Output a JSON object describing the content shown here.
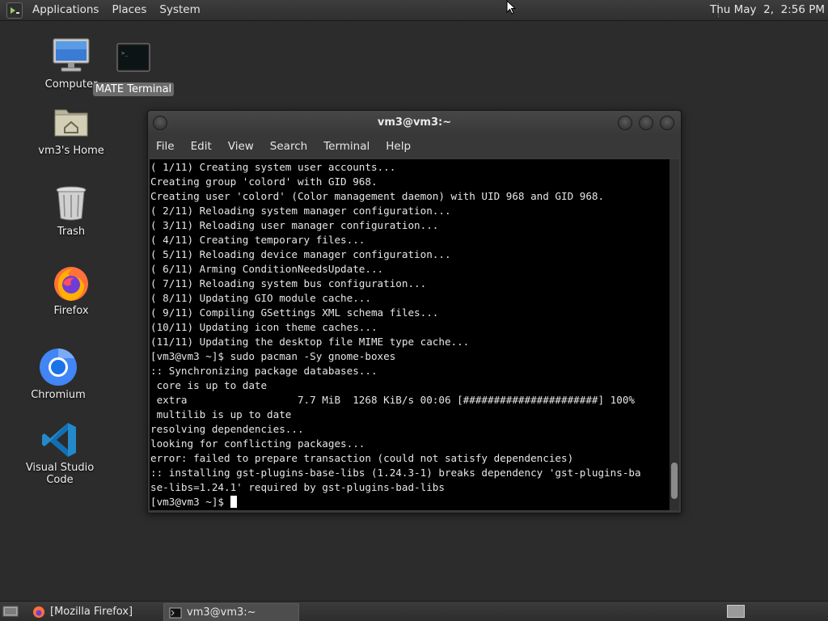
{
  "top_panel": {
    "menus": [
      "Applications",
      "Places",
      "System"
    ],
    "clock": "Thu May  2,  2:56 PM"
  },
  "desktop_icons": [
    {
      "label": "Computer",
      "icon": "computer-icon"
    },
    {
      "label": "MATE Terminal",
      "icon": "terminal-icon",
      "selected": true
    },
    {
      "label": "vm3's Home",
      "icon": "home-folder-icon"
    },
    {
      "label": "Trash",
      "icon": "trash-icon"
    },
    {
      "label": "Firefox",
      "icon": "firefox-icon"
    },
    {
      "label": "Chromium",
      "icon": "chromium-icon"
    },
    {
      "label": "Visual Studio Code",
      "icon": "vscode-icon"
    }
  ],
  "terminal": {
    "title": "vm3@vm3:~",
    "menu": [
      "File",
      "Edit",
      "View",
      "Search",
      "Terminal",
      "Help"
    ],
    "lines": [
      "( 1/11) Creating system user accounts...",
      "Creating group 'colord' with GID 968.",
      "Creating user 'colord' (Color management daemon) with UID 968 and GID 968.",
      "( 2/11) Reloading system manager configuration...",
      "( 3/11) Reloading user manager configuration...",
      "( 4/11) Creating temporary files...",
      "( 5/11) Reloading device manager configuration...",
      "( 6/11) Arming ConditionNeedsUpdate...",
      "( 7/11) Reloading system bus configuration...",
      "( 8/11) Updating GIO module cache...",
      "( 9/11) Compiling GSettings XML schema files...",
      "(10/11) Updating icon theme caches...",
      "(11/11) Updating the desktop file MIME type cache...",
      "[vm3@vm3 ~]$ sudo pacman -Sy gnome-boxes",
      ":: Synchronizing package databases...",
      " core is up to date",
      " extra                  7.7 MiB  1268 KiB/s 00:06 [######################] 100%",
      " multilib is up to date",
      "resolving dependencies...",
      "looking for conflicting packages...",
      "error: failed to prepare transaction (could not satisfy dependencies)",
      ":: installing gst-plugins-base-libs (1.24.3-1) breaks dependency 'gst-plugins-ba",
      "se-libs=1.24.1' required by gst-plugins-bad-libs"
    ],
    "prompt": "[vm3@vm3 ~]$ "
  },
  "taskbar": [
    {
      "label": "[Mozilla Firefox]",
      "icon": "firefox-icon",
      "active": false
    },
    {
      "label": "vm3@vm3:~",
      "icon": "terminal-icon",
      "active": true
    }
  ],
  "colors": {
    "panel": "#333333",
    "desktop": "#2c2c2c",
    "terminal_bg": "#000000",
    "terminal_fg": "#e6e6e6"
  }
}
